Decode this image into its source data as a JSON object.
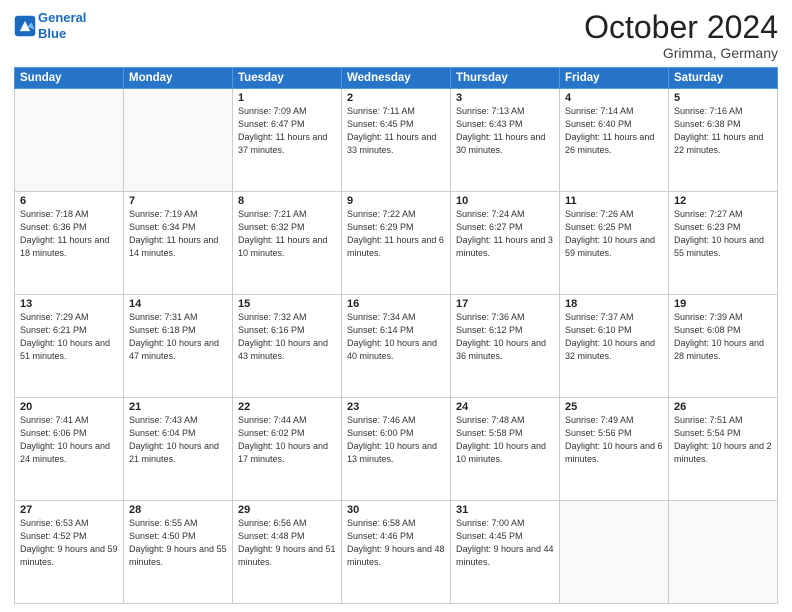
{
  "header": {
    "logo_line1": "General",
    "logo_line2": "Blue",
    "month": "October 2024",
    "location": "Grimma, Germany"
  },
  "weekdays": [
    "Sunday",
    "Monday",
    "Tuesday",
    "Wednesday",
    "Thursday",
    "Friday",
    "Saturday"
  ],
  "weeks": [
    [
      {
        "day": "",
        "detail": ""
      },
      {
        "day": "",
        "detail": ""
      },
      {
        "day": "1",
        "detail": "Sunrise: 7:09 AM\nSunset: 6:47 PM\nDaylight: 11 hours and 37 minutes."
      },
      {
        "day": "2",
        "detail": "Sunrise: 7:11 AM\nSunset: 6:45 PM\nDaylight: 11 hours and 33 minutes."
      },
      {
        "day": "3",
        "detail": "Sunrise: 7:13 AM\nSunset: 6:43 PM\nDaylight: 11 hours and 30 minutes."
      },
      {
        "day": "4",
        "detail": "Sunrise: 7:14 AM\nSunset: 6:40 PM\nDaylight: 11 hours and 26 minutes."
      },
      {
        "day": "5",
        "detail": "Sunrise: 7:16 AM\nSunset: 6:38 PM\nDaylight: 11 hours and 22 minutes."
      }
    ],
    [
      {
        "day": "6",
        "detail": "Sunrise: 7:18 AM\nSunset: 6:36 PM\nDaylight: 11 hours and 18 minutes."
      },
      {
        "day": "7",
        "detail": "Sunrise: 7:19 AM\nSunset: 6:34 PM\nDaylight: 11 hours and 14 minutes."
      },
      {
        "day": "8",
        "detail": "Sunrise: 7:21 AM\nSunset: 6:32 PM\nDaylight: 11 hours and 10 minutes."
      },
      {
        "day": "9",
        "detail": "Sunrise: 7:22 AM\nSunset: 6:29 PM\nDaylight: 11 hours and 6 minutes."
      },
      {
        "day": "10",
        "detail": "Sunrise: 7:24 AM\nSunset: 6:27 PM\nDaylight: 11 hours and 3 minutes."
      },
      {
        "day": "11",
        "detail": "Sunrise: 7:26 AM\nSunset: 6:25 PM\nDaylight: 10 hours and 59 minutes."
      },
      {
        "day": "12",
        "detail": "Sunrise: 7:27 AM\nSunset: 6:23 PM\nDaylight: 10 hours and 55 minutes."
      }
    ],
    [
      {
        "day": "13",
        "detail": "Sunrise: 7:29 AM\nSunset: 6:21 PM\nDaylight: 10 hours and 51 minutes."
      },
      {
        "day": "14",
        "detail": "Sunrise: 7:31 AM\nSunset: 6:18 PM\nDaylight: 10 hours and 47 minutes."
      },
      {
        "day": "15",
        "detail": "Sunrise: 7:32 AM\nSunset: 6:16 PM\nDaylight: 10 hours and 43 minutes."
      },
      {
        "day": "16",
        "detail": "Sunrise: 7:34 AM\nSunset: 6:14 PM\nDaylight: 10 hours and 40 minutes."
      },
      {
        "day": "17",
        "detail": "Sunrise: 7:36 AM\nSunset: 6:12 PM\nDaylight: 10 hours and 36 minutes."
      },
      {
        "day": "18",
        "detail": "Sunrise: 7:37 AM\nSunset: 6:10 PM\nDaylight: 10 hours and 32 minutes."
      },
      {
        "day": "19",
        "detail": "Sunrise: 7:39 AM\nSunset: 6:08 PM\nDaylight: 10 hours and 28 minutes."
      }
    ],
    [
      {
        "day": "20",
        "detail": "Sunrise: 7:41 AM\nSunset: 6:06 PM\nDaylight: 10 hours and 24 minutes."
      },
      {
        "day": "21",
        "detail": "Sunrise: 7:43 AM\nSunset: 6:04 PM\nDaylight: 10 hours and 21 minutes."
      },
      {
        "day": "22",
        "detail": "Sunrise: 7:44 AM\nSunset: 6:02 PM\nDaylight: 10 hours and 17 minutes."
      },
      {
        "day": "23",
        "detail": "Sunrise: 7:46 AM\nSunset: 6:00 PM\nDaylight: 10 hours and 13 minutes."
      },
      {
        "day": "24",
        "detail": "Sunrise: 7:48 AM\nSunset: 5:58 PM\nDaylight: 10 hours and 10 minutes."
      },
      {
        "day": "25",
        "detail": "Sunrise: 7:49 AM\nSunset: 5:56 PM\nDaylight: 10 hours and 6 minutes."
      },
      {
        "day": "26",
        "detail": "Sunrise: 7:51 AM\nSunset: 5:54 PM\nDaylight: 10 hours and 2 minutes."
      }
    ],
    [
      {
        "day": "27",
        "detail": "Sunrise: 6:53 AM\nSunset: 4:52 PM\nDaylight: 9 hours and 59 minutes."
      },
      {
        "day": "28",
        "detail": "Sunrise: 6:55 AM\nSunset: 4:50 PM\nDaylight: 9 hours and 55 minutes."
      },
      {
        "day": "29",
        "detail": "Sunrise: 6:56 AM\nSunset: 4:48 PM\nDaylight: 9 hours and 51 minutes."
      },
      {
        "day": "30",
        "detail": "Sunrise: 6:58 AM\nSunset: 4:46 PM\nDaylight: 9 hours and 48 minutes."
      },
      {
        "day": "31",
        "detail": "Sunrise: 7:00 AM\nSunset: 4:45 PM\nDaylight: 9 hours and 44 minutes."
      },
      {
        "day": "",
        "detail": ""
      },
      {
        "day": "",
        "detail": ""
      }
    ]
  ]
}
